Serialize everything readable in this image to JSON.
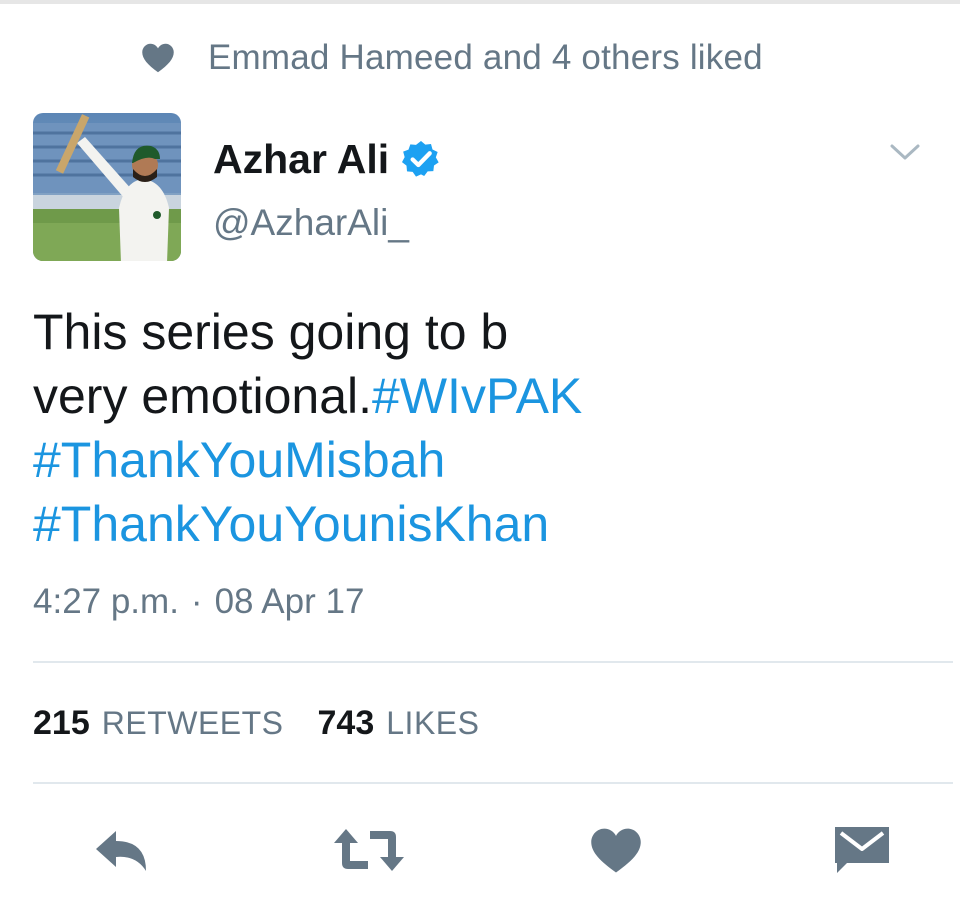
{
  "social_context": {
    "icon": "heart-icon",
    "text": "Emmad Hameed and 4 others liked"
  },
  "author": {
    "name": "Azhar Ali",
    "handle": "@AzharAli_",
    "verified": true,
    "avatar": "profile-photo-cricketer"
  },
  "tweet": {
    "lines": [
      {
        "plain": "This series going to b",
        "tag": ""
      },
      {
        "plain": "very emotional.",
        "tag": "#WIvPAK"
      },
      {
        "plain": "",
        "tag": "#ThankYouMisbah"
      },
      {
        "plain": "",
        "tag": "#ThankYouYounisKhan"
      }
    ]
  },
  "meta": {
    "time": "4:27 p.m.",
    "separator": "·",
    "date": "08 Apr 17"
  },
  "stats": {
    "retweets_count": "215",
    "retweets_label": "RETWEETS",
    "likes_count": "743",
    "likes_label": "LIKES"
  },
  "actions": [
    {
      "name": "reply",
      "icon": "reply-icon"
    },
    {
      "name": "retweet",
      "icon": "retweet-icon"
    },
    {
      "name": "like",
      "icon": "heart-icon"
    },
    {
      "name": "direct-message",
      "icon": "envelope-icon"
    }
  ],
  "colors": {
    "text": "#14171a",
    "secondary": "#657786",
    "link": "#1b95e0",
    "verified": "#1da1f2",
    "icon": "#657786",
    "divider": "#e1e8ed"
  }
}
